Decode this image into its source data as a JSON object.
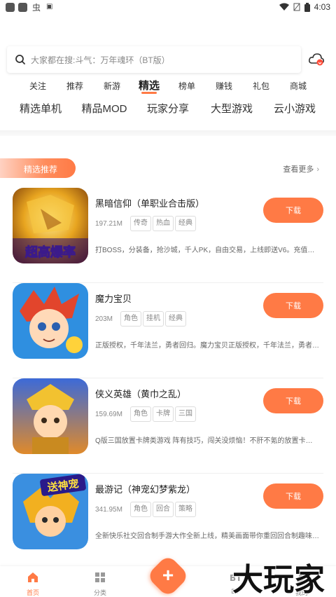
{
  "status_bar": {
    "time": "4:03"
  },
  "search": {
    "placeholder": "大家都在搜:斗气：万年魂环（BT版）"
  },
  "top_tabs": [
    "关注",
    "推荐",
    "新游",
    "精选",
    "榜单",
    "赚钱",
    "礼包",
    "商城"
  ],
  "active_tab": "精选",
  "sub_categories": [
    "精选单机",
    "精品MOD",
    "玩家分享",
    "大型游戏",
    "云小游戏"
  ],
  "section": {
    "title": "精选推荐",
    "more": "查看更多"
  },
  "games": [
    {
      "name": "黑暗信仰（单职业合击版）",
      "size": "197.21M",
      "tags": [
        "传奇",
        "热血",
        "经典"
      ],
      "desc": "打BOSS，分装备，抢沙城，千人PK，自由交易，上线即送V6。充值比例...",
      "icon_text": "超高爆率",
      "button": "下载"
    },
    {
      "name": "魔力宝贝",
      "size": "203M",
      "tags": [
        "角色",
        "挂机",
        "经典"
      ],
      "desc": "正版授权，千年法兰，勇者回归。魔力宝贝正版授权，千年法兰，勇者回...",
      "icon_text": "",
      "button": "下载"
    },
    {
      "name": "侠义英雄（黄巾之乱）",
      "size": "159.69M",
      "tags": [
        "角色",
        "卡牌",
        "三国"
      ],
      "desc": "Q版三国放置卡牌类游戏 阵有技巧，闯关没烦恼！不肝不氪的放置卡牌三国...",
      "icon_text": "",
      "button": "下载"
    },
    {
      "name": "最游记（神宠幻梦紫龙）",
      "size": "341.95M",
      "tags": [
        "角色",
        "回合",
        "策略"
      ],
      "desc": "全新快乐社交回合制手游大作全新上线，精美画面带你重回回合制趣味之...",
      "icon_text": "送神宠",
      "button": "下载"
    }
  ],
  "bottom_nav": [
    {
      "label": "首页",
      "icon": "home-icon"
    },
    {
      "label": "分类",
      "icon": "grid-icon"
    },
    {
      "label": "BT",
      "icon": "bt-icon"
    },
    {
      "label": "我的",
      "icon": "profile-icon"
    }
  ],
  "fab": {
    "label": "+"
  },
  "watermark": "大玩家",
  "colors": {
    "accent": "#ff7a45",
    "text": "#222222",
    "muted": "#888888"
  }
}
